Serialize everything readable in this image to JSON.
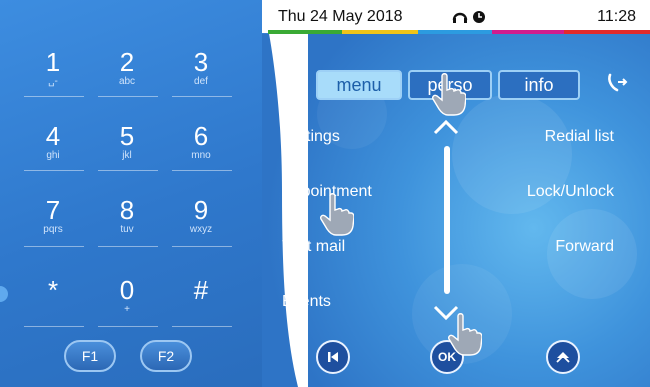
{
  "status": {
    "date": "Thu 24 May 2018",
    "time": "11:28",
    "icons": [
      "headset-icon",
      "clock-icon"
    ],
    "color_segments": [
      "#3aaa35",
      "#f0c419",
      "#2c9be0",
      "#d11d8e",
      "#e22b2b"
    ]
  },
  "keypad": {
    "keys": [
      {
        "num": "1",
        "sub": "␣-"
      },
      {
        "num": "2",
        "sub": "abc"
      },
      {
        "num": "3",
        "sub": "def"
      },
      {
        "num": "4",
        "sub": "ghi"
      },
      {
        "num": "5",
        "sub": "jkl"
      },
      {
        "num": "6",
        "sub": "mno"
      },
      {
        "num": "7",
        "sub": "pqrs"
      },
      {
        "num": "8",
        "sub": "tuv"
      },
      {
        "num": "9",
        "sub": "wxyz"
      },
      {
        "num": "*",
        "sub": ""
      },
      {
        "num": "0",
        "sub": "+"
      },
      {
        "num": "#",
        "sub": ""
      }
    ],
    "f1": "F1",
    "f2": "F2"
  },
  "tabs": [
    {
      "label": "menu",
      "active": true
    },
    {
      "label": "perso",
      "active": false
    },
    {
      "label": "info",
      "active": false
    }
  ],
  "menu_left": [
    "Settings",
    "Appointment",
    "Text mail",
    "Events"
  ],
  "menu_right": [
    "Redial list",
    "Lock/Unlock",
    "Forward"
  ],
  "softkeys": {
    "back_icon": "skip-back-icon",
    "ok": "OK",
    "home_icon": "home-up-icon"
  }
}
